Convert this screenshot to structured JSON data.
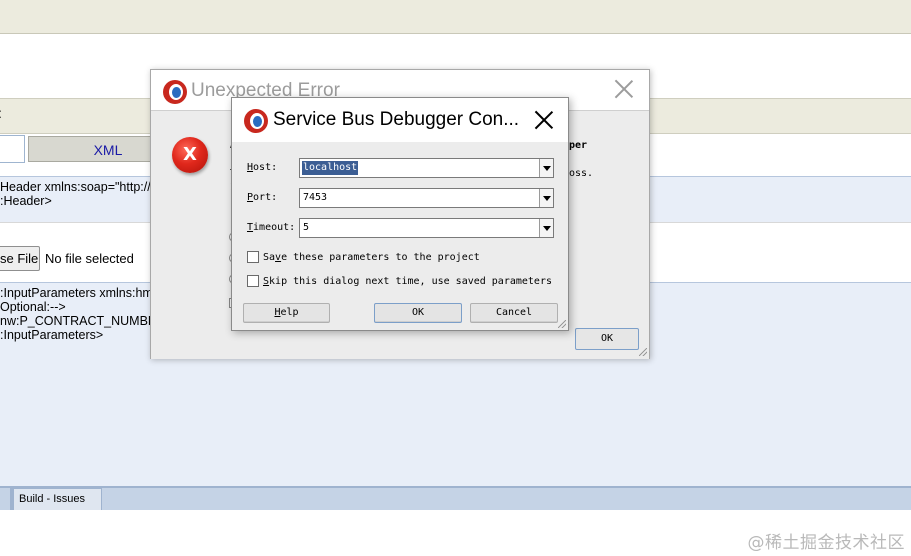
{
  "background": {
    "strip_colon": ":",
    "xml_tab_label": "XML",
    "code_lines_top": [
      "Header xmlns:soap=\"http://",
      ":Header>"
    ],
    "choose_file_label": "se File",
    "no_file_text": "No file selected",
    "code_lines_bottom": [
      ":InputParameters xmlns:hmw",
      "Optional:-->",
      "nw:P_CONTRACT_NUMBER>",
      ":InputParameters>"
    ],
    "bottom_tab_label": "Build - Issues",
    "watermark": "@稀土掘金技术社区"
  },
  "error_window": {
    "title": "Unexpected Error",
    "icon_glyph": "X",
    "partial_text": [
      "A",
      "pper",
      "T",
      "oss.",
      "I"
    ],
    "ok_label": "OK"
  },
  "connection_dialog": {
    "title": "Service Bus Debugger Con...",
    "host": {
      "label_key": "H",
      "label_rest": "ost:",
      "value": "localhost"
    },
    "port": {
      "label_key": "P",
      "label_rest": "ort:",
      "value": "7453"
    },
    "timeout": {
      "label_key": "T",
      "label_rest": "imeout:",
      "value": "5"
    },
    "save_params": {
      "key": "v",
      "pre": "Sa",
      "post": "e these parameters to the project",
      "checked": false
    },
    "skip_dialog": {
      "key": "S",
      "pre": "",
      "post": "kip this dialog next time, use saved parameters",
      "checked": false
    },
    "buttons": {
      "help": {
        "key": "H",
        "rest": "elp"
      },
      "ok": "OK",
      "cancel": "Cancel"
    }
  },
  "colors": {
    "selection": "#3c5e94",
    "error_red": "#e0281c",
    "logo_red": "#c8281e",
    "logo_blue": "#2a6cc0",
    "panel_blue": "#e8eef8"
  }
}
